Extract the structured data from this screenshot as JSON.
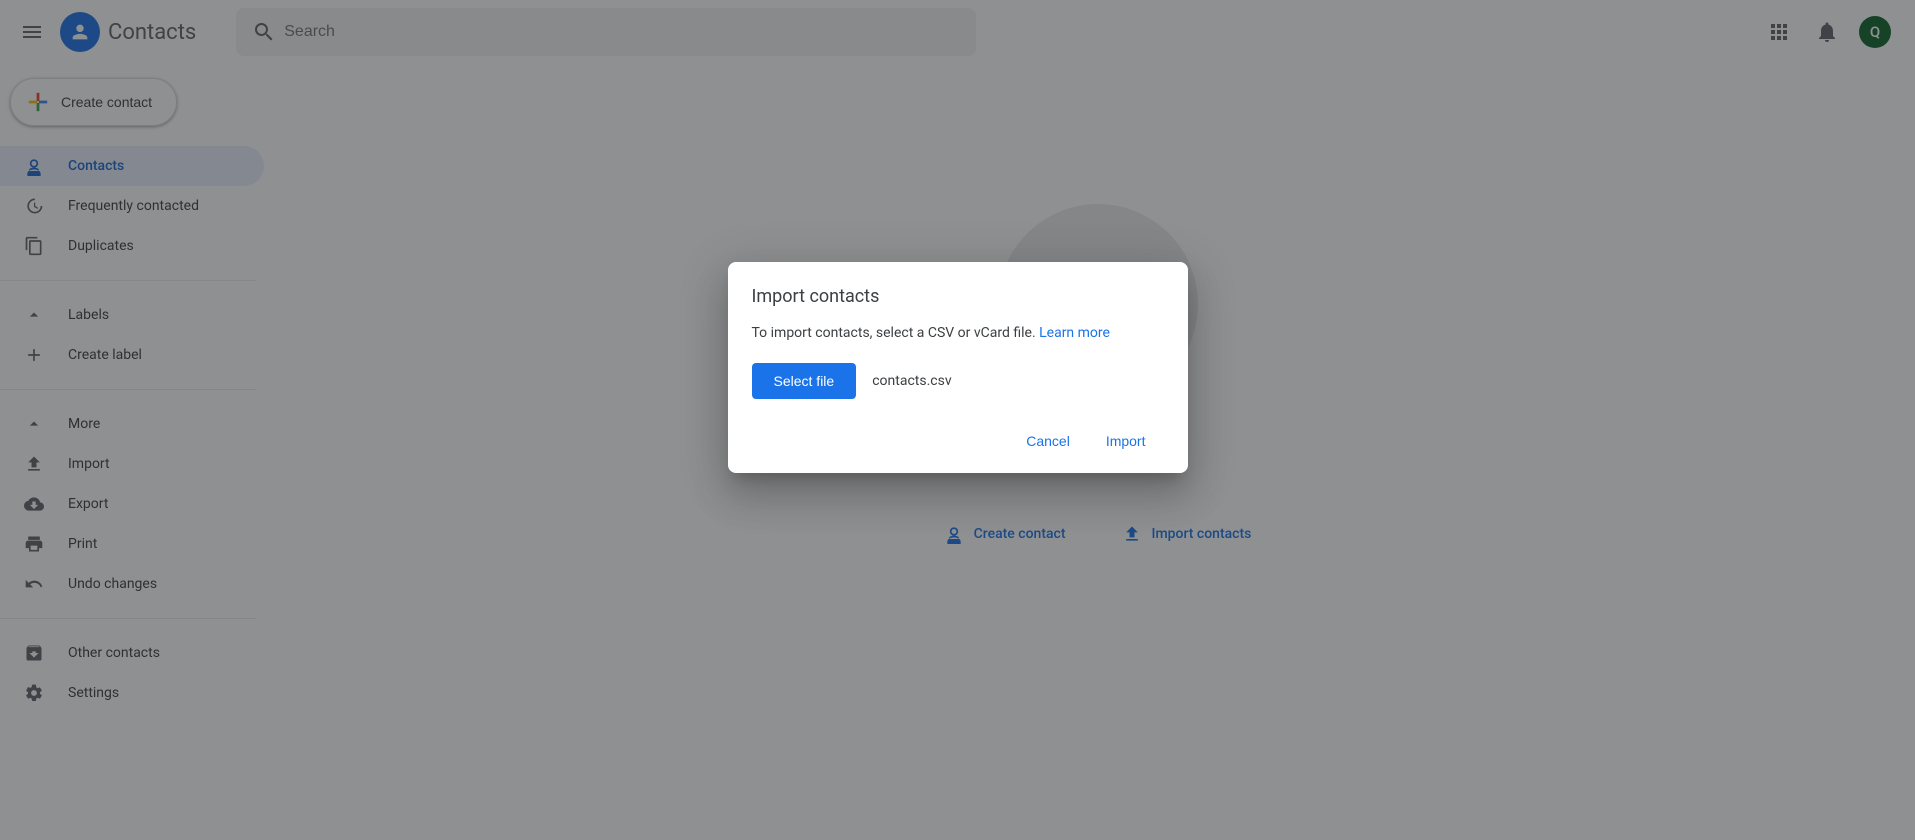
{
  "header": {
    "app_title": "Contacts",
    "search_placeholder": "Search",
    "avatar_letter": "Q"
  },
  "sidebar": {
    "create_label": "Create contact",
    "nav1": {
      "contacts": "Contacts",
      "frequent": "Frequently contacted",
      "duplicates": "Duplicates"
    },
    "labels": {
      "header": "Labels",
      "create": "Create label"
    },
    "more": {
      "header": "More",
      "import": "Import",
      "export": "Export",
      "print": "Print",
      "undo": "Undo changes"
    },
    "bottom": {
      "other": "Other contacts",
      "settings": "Settings"
    }
  },
  "main": {
    "create_contact": "Create contact",
    "import_contacts": "Import contacts"
  },
  "dialog": {
    "title": "Import contacts",
    "body_text": "To import contacts, select a CSV or vCard file. ",
    "learn_more": "Learn more",
    "select_file_label": "Select file",
    "selected_filename": "contacts.csv",
    "cancel_label": "Cancel",
    "import_label": "Import"
  }
}
